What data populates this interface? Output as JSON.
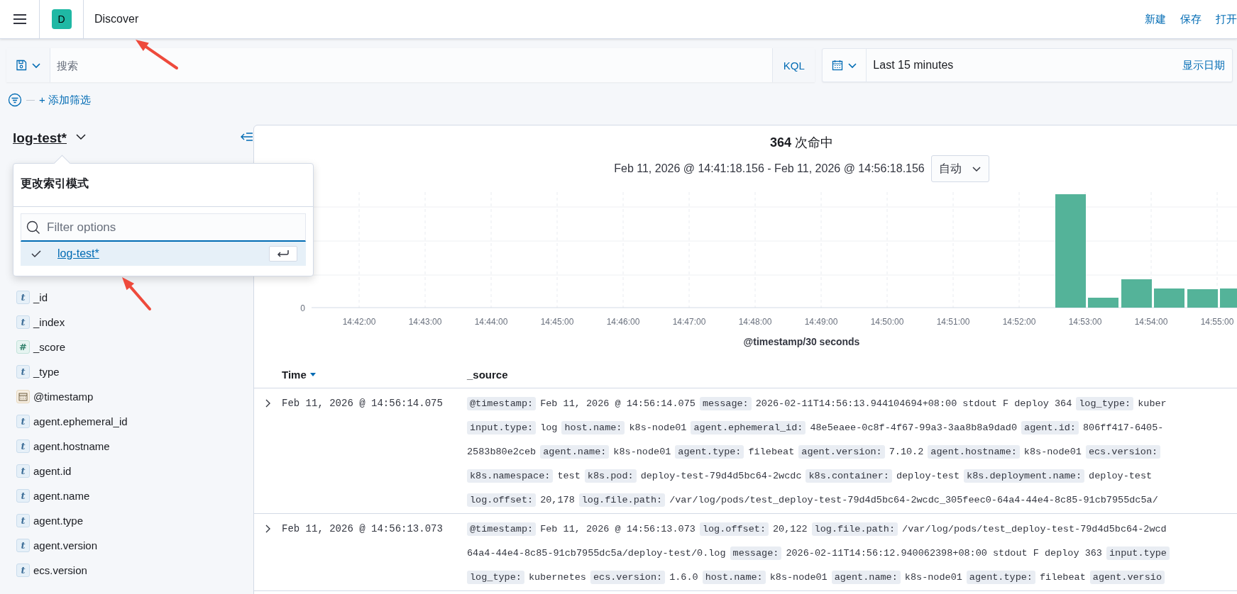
{
  "header": {
    "app_badge": "D",
    "title": "Discover",
    "actions": [
      "新建",
      "保存",
      "打开"
    ]
  },
  "query_bar": {
    "placeholder": "搜索",
    "language": "KQL"
  },
  "date_picker": {
    "value": "Last 15 minutes",
    "show_dates": "显示日期"
  },
  "filter_bar": {
    "add_filter": "+ 添加筛选"
  },
  "sidebar": {
    "index_pattern": "log-test*",
    "fields": [
      {
        "name": "_id",
        "kind": "string",
        "glyph": "t"
      },
      {
        "name": "_index",
        "kind": "string",
        "glyph": "t"
      },
      {
        "name": "_score",
        "kind": "number",
        "glyph": "#"
      },
      {
        "name": "_type",
        "kind": "string",
        "glyph": "t"
      },
      {
        "name": "@timestamp",
        "kind": "date"
      },
      {
        "name": "agent.ephemeral_id",
        "kind": "string",
        "glyph": "t"
      },
      {
        "name": "agent.hostname",
        "kind": "string",
        "glyph": "t"
      },
      {
        "name": "agent.id",
        "kind": "string",
        "glyph": "t"
      },
      {
        "name": "agent.name",
        "kind": "string",
        "glyph": "t"
      },
      {
        "name": "agent.type",
        "kind": "string",
        "glyph": "t"
      },
      {
        "name": "agent.version",
        "kind": "string",
        "glyph": "t"
      },
      {
        "name": "ecs.version",
        "kind": "string",
        "glyph": "t"
      }
    ]
  },
  "index_pattern_popover": {
    "title": "更改索引模式",
    "placeholder": "Filter options",
    "options": [
      {
        "label": "log-test*",
        "selected": true
      }
    ]
  },
  "histogram": {
    "hits": "**364** 次命中",
    "time_range": "Feb 11, 2026 @ 14:41:18.156 - Feb 11, 2026 @ 14:56:18.156",
    "interval": "自动",
    "y_tick": "0",
    "x_ticks": [
      "14:42:00",
      "14:43:00",
      "14:44:00",
      "14:45:00",
      "14:46:00",
      "14:47:00",
      "14:48:00",
      "14:49:00",
      "14:50:00",
      "14:51:00",
      "14:52:00",
      "14:53:00",
      "14:54:00",
      "14:55:00"
    ],
    "x_axis_title": "@timestamp/30 seconds"
  },
  "table": {
    "columns": [
      {
        "label": "Time",
        "sort_descending": true
      },
      {
        "label": "_source"
      }
    ],
    "rows": [
      {
        "time": "Feb 11, 2026 @ 14:56:14.075",
        "lines": [
          [
            {
              "field": "@timestamp:",
              "value": "Feb 11, 2026 @ 14:56:14.075"
            },
            {
              "field": "message:",
              "value": "2026-02-11T14:56:13.944104694+08:00 stdout F deploy 364"
            },
            {
              "field": "log_type:",
              "value": "kuber"
            }
          ],
          [
            {
              "field": "input.type:",
              "value": "log"
            },
            {
              "field": "host.name:",
              "value": "k8s-node01"
            },
            {
              "field": "agent.ephemeral_id:",
              "value": "48e5eaee-0c8f-4f67-99a3-3aa8b8a9dad0"
            },
            {
              "field": "agent.id:",
              "value": "806ff417-6405-"
            }
          ],
          [
            {
              "value": "2583b80e2ceb"
            },
            {
              "field": "agent.name:",
              "value": "k8s-node01"
            },
            {
              "field": "agent.type:",
              "value": "filebeat"
            },
            {
              "field": "agent.version:",
              "value": "7.10.2"
            },
            {
              "field": "agent.hostname:",
              "value": "k8s-node01"
            },
            {
              "field": "ecs.version:"
            }
          ],
          [
            {
              "field": "k8s.namespace:",
              "value": "test"
            },
            {
              "field": "k8s.pod:",
              "value": "deploy-test-79d4d5bc64-2wcdc"
            },
            {
              "field": "k8s.container:",
              "value": "deploy-test"
            },
            {
              "field": "k8s.deployment.name:",
              "value": "deploy-test"
            }
          ],
          [
            {
              "field": "log.offset:",
              "value": "20,178"
            },
            {
              "field": "log.file.path:",
              "value": "/var/log/pods/test_deploy-test-79d4d5bc64-2wcdc_305feec0-64a4-44e4-8c85-91cb7955dc5a/"
            }
          ]
        ]
      },
      {
        "time": "Feb 11, 2026 @ 14:56:13.073",
        "lines": [
          [
            {
              "field": "@timestamp:",
              "value": "Feb 11, 2026 @ 14:56:13.073"
            },
            {
              "field": "log.offset:",
              "value": "20,122"
            },
            {
              "field": "log.file.path:",
              "value": "/var/log/pods/test_deploy-test-79d4d5bc64-2wcd"
            }
          ],
          [
            {
              "value": "64a4-44e4-8c85-91cb7955dc5a/deploy-test/0.log"
            },
            {
              "field": "message:",
              "value": "2026-02-11T14:56:12.940062398+08:00 stdout F deploy 363"
            },
            {
              "field": "input.type"
            }
          ],
          [
            {
              "field": "log_type:",
              "value": "kubernetes"
            },
            {
              "field": "ecs.version:",
              "value": "1.6.0"
            },
            {
              "field": "host.name:",
              "value": "k8s-node01"
            },
            {
              "field": "agent.name:",
              "value": "k8s-node01"
            },
            {
              "field": "agent.type:",
              "value": "filebeat"
            },
            {
              "field": "agent.versio"
            }
          ]
        ]
      }
    ]
  }
}
